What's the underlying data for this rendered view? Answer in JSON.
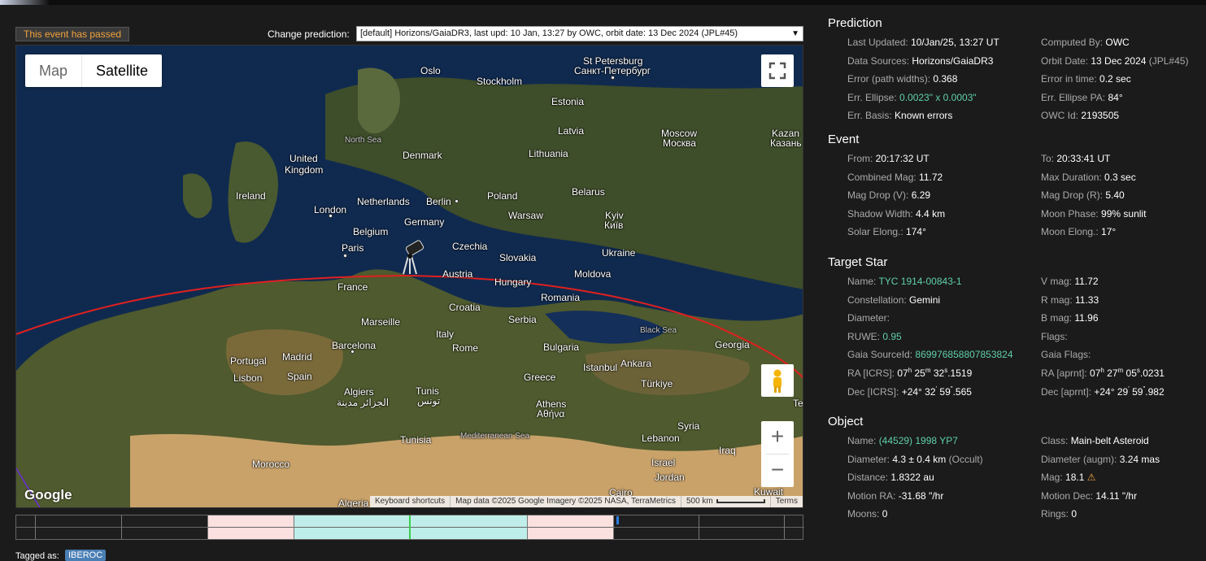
{
  "badge": "This event has passed",
  "prediction_selector": {
    "label": "Change prediction:",
    "value": "[default] Horizons/GaiaDR3, last upd: 10 Jan, 13:27 by OWC, orbit date: 13 Dec 2024 (JPL#45)"
  },
  "map": {
    "type_buttons": [
      "Map",
      "Satellite"
    ],
    "logo": "Google",
    "attribution": [
      "Keyboard shortcuts",
      "Map data ©2025 Google Imagery ©2025 NASA, TerraMetrics",
      "500 km",
      "Terms"
    ],
    "labels": [
      {
        "t": "St Petersburg",
        "cls": ""
      },
      {
        "t": "Санкт-Петербург",
        "cls": ""
      },
      {
        "t": "Oslo",
        "cls": ""
      },
      {
        "t": "Stockholm",
        "cls": ""
      },
      {
        "t": "Estonia",
        "cls": ""
      },
      {
        "t": "Latvia",
        "cls": ""
      },
      {
        "t": "Moscow",
        "cls": ""
      },
      {
        "t": "Москва",
        "cls": ""
      },
      {
        "t": "Kazan",
        "cls": ""
      },
      {
        "t": "Казань",
        "cls": ""
      },
      {
        "t": "North Sea",
        "cls": "small"
      },
      {
        "t": "Denmark",
        "cls": ""
      },
      {
        "t": "Lithuania",
        "cls": ""
      },
      {
        "t": "United",
        "cls": ""
      },
      {
        "t": "Kingdom",
        "cls": ""
      },
      {
        "t": "Ireland",
        "cls": ""
      },
      {
        "t": "London",
        "cls": ""
      },
      {
        "t": "Netherlands",
        "cls": ""
      },
      {
        "t": "Berlin",
        "cls": ""
      },
      {
        "t": "Poland",
        "cls": ""
      },
      {
        "t": "Belarus",
        "cls": ""
      },
      {
        "t": "Germany",
        "cls": ""
      },
      {
        "t": "Warsaw",
        "cls": ""
      },
      {
        "t": "Kyiv",
        "cls": ""
      },
      {
        "t": "Київ",
        "cls": ""
      },
      {
        "t": "Belgium",
        "cls": ""
      },
      {
        "t": "Paris",
        "cls": ""
      },
      {
        "t": "Czechia",
        "cls": ""
      },
      {
        "t": "Slovakia",
        "cls": ""
      },
      {
        "t": "Ukraine",
        "cls": ""
      },
      {
        "t": "Austria",
        "cls": ""
      },
      {
        "t": "Moldova",
        "cls": ""
      },
      {
        "t": "France",
        "cls": ""
      },
      {
        "t": "Hungary",
        "cls": ""
      },
      {
        "t": "Romania",
        "cls": ""
      },
      {
        "t": "Croatia",
        "cls": ""
      },
      {
        "t": "Serbia",
        "cls": ""
      },
      {
        "t": "Marseille",
        "cls": ""
      },
      {
        "t": "Italy",
        "cls": ""
      },
      {
        "t": "Portugal",
        "cls": ""
      },
      {
        "t": "Madrid",
        "cls": ""
      },
      {
        "t": "Barcelona",
        "cls": ""
      },
      {
        "t": "Rome",
        "cls": ""
      },
      {
        "t": "Bulgaria",
        "cls": ""
      },
      {
        "t": "Georgia",
        "cls": ""
      },
      {
        "t": "Lisbon",
        "cls": ""
      },
      {
        "t": "Spain",
        "cls": ""
      },
      {
        "t": "Istanbul",
        "cls": ""
      },
      {
        "t": "Ankara",
        "cls": ""
      },
      {
        "t": "Greece",
        "cls": ""
      },
      {
        "t": "Türkiye",
        "cls": ""
      },
      {
        "t": "Algiers",
        "cls": ""
      },
      {
        "t": "الجزائر مدينة",
        "cls": ""
      },
      {
        "t": "Tunis",
        "cls": ""
      },
      {
        "t": "تونس",
        "cls": ""
      },
      {
        "t": "Athens",
        "cls": ""
      },
      {
        "t": "Αθήνα",
        "cls": ""
      },
      {
        "t": "Syria",
        "cls": ""
      },
      {
        "t": "Tunisia",
        "cls": ""
      },
      {
        "t": "Mediterranean Sea",
        "cls": "small"
      },
      {
        "t": "Lebanon",
        "cls": ""
      },
      {
        "t": "Iraq",
        "cls": ""
      },
      {
        "t": "Morocco",
        "cls": ""
      },
      {
        "t": "Israel",
        "cls": ""
      },
      {
        "t": "Jordan",
        "cls": ""
      },
      {
        "t": "Cairo",
        "cls": ""
      },
      {
        "t": "Kuwait",
        "cls": ""
      },
      {
        "t": "Algeria",
        "cls": ""
      },
      {
        "t": "Black Sea",
        "cls": "small"
      },
      {
        "t": "Te",
        "cls": ""
      }
    ]
  },
  "tagged": {
    "label": "Tagged as:",
    "tag": "IBEROC"
  },
  "prediction": {
    "title": "Prediction",
    "rows": [
      [
        "Last Updated: ",
        "10/Jan/25, 13:27 UT",
        "",
        "Computed By: ",
        "OWC",
        ""
      ],
      [
        "Data Sources: ",
        "Horizons/GaiaDR3",
        "",
        "Orbit Date: ",
        "13 Dec 2024",
        " (JPL#45)"
      ],
      [
        "Error (path widths): ",
        "0.368",
        "",
        "Error in time: ",
        "0.2 sec",
        ""
      ],
      [
        "Err. Ellipse: ",
        "0.0023\" x 0.0003\"",
        "g",
        "Err. Ellipse PA: ",
        "84°",
        ""
      ],
      [
        "Err. Basis: ",
        "Known errors",
        "",
        "OWC Id: ",
        "2193505",
        ""
      ]
    ]
  },
  "event": {
    "title": "Event",
    "rows": [
      [
        "From: ",
        "20:17:32 UT",
        "To: ",
        "20:33:41 UT"
      ],
      [
        "Combined Mag: ",
        "11.72",
        "Max Duration: ",
        "0.3 sec"
      ],
      [
        "Mag Drop (V): ",
        "6.29",
        "Mag Drop (R): ",
        "5.40"
      ],
      [
        "Shadow Width: ",
        "4.4 km",
        "Moon Phase: ",
        "99% sunlit"
      ],
      [
        "Solar Elong.: ",
        "174°",
        "Moon Elong.: ",
        "17°"
      ]
    ]
  },
  "target_star": {
    "title": "Target Star",
    "name_label": "Name: ",
    "name": "TYC 1914-00843-1",
    "vmag_label": "V mag: ",
    "vmag": "11.72",
    "const_label": "Constellation: ",
    "const": "Gemini",
    "rmag_label": "R mag: ",
    "rmag": "11.33",
    "diam_label": "Diameter:",
    "bmag_label": "B mag: ",
    "bmag": "11.96",
    "ruwe_label": "RUWE: ",
    "ruwe": "0.95",
    "flags_label": "Flags:",
    "gaia_label": "Gaia SourceId: ",
    "gaia": "869976858807853824",
    "gaiaflags_label": "Gaia Flags:",
    "ra_icrs_label": "RA [ICRS]: ",
    "ra_icrs": [
      "07",
      "h",
      " 25",
      "m",
      " 32",
      "s",
      ".1519"
    ],
    "ra_aprnt_label": "RA [aprnt]: ",
    "ra_aprnt": [
      "07",
      "h",
      " 27",
      "m",
      " 05",
      "s",
      ".0231"
    ],
    "dec_icrs_label": "Dec [ICRS]: ",
    "dec_icrs": [
      "+24° 32",
      "'",
      " 59",
      "\"",
      ".565"
    ],
    "dec_aprnt_label": "Dec [aprnt]: ",
    "dec_aprnt": [
      "+24° 29",
      "'",
      " 59",
      "\"",
      ".982"
    ]
  },
  "object": {
    "title": "Object",
    "name_label": "Name: ",
    "name": "(44529) 1998 YP7",
    "class_label": "Class: ",
    "class": "Main-belt Asteroid",
    "diam_label": "Diameter: ",
    "diam": "4.3 ± 0.4 km",
    "diam_src": " (Occult)",
    "diam_augm_label": "Diameter (augm): ",
    "diam_augm": "3.24 mas",
    "dist_label": "Distance: ",
    "dist": "1.8322 au",
    "mag_label": "Mag: ",
    "mag": "18.1",
    "mag_icon": "warning-icon",
    "mra_label": "Motion RA: ",
    "mra": "-31.68 \"/hr",
    "mdec_label": "Motion Dec: ",
    "mdec": "14.11 \"/hr",
    "moons_label": "Moons: ",
    "moons": "0",
    "rings_label": "Rings: ",
    "rings": "0"
  },
  "colors": {
    "accent_green": "#5fd0a8",
    "badge_orange": "#f0a23c",
    "path_red": "#e02020",
    "tag_blue": "#4a7fb5"
  }
}
